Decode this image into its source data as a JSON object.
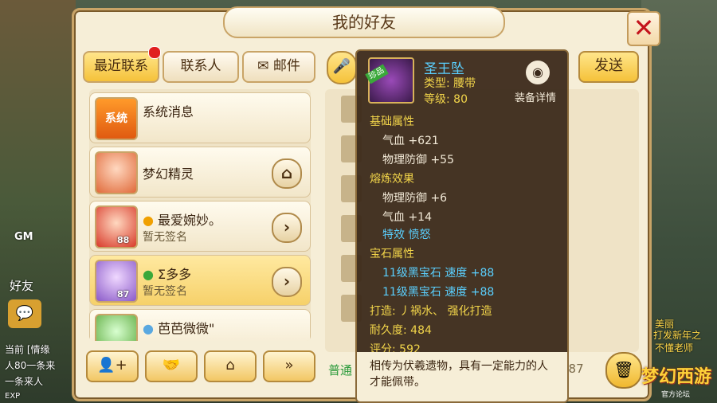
{
  "window": {
    "title": "我的好友",
    "close_label": "✕"
  },
  "tabs": [
    {
      "label": "最近联系",
      "active": true
    },
    {
      "label": "联系人",
      "active": false
    },
    {
      "label": "邮件",
      "active": false
    }
  ],
  "contacts": [
    {
      "name": "系统消息",
      "sub": "",
      "level": "",
      "icon": "系统"
    },
    {
      "name": "梦幻精灵",
      "sub": "",
      "level": ""
    },
    {
      "name": "最爱婉妙。",
      "sub": "暂无签名",
      "level": "88"
    },
    {
      "name": "Σ多多",
      "sub": "暂无签名",
      "level": "87"
    },
    {
      "name": "芭芭微微\"",
      "sub": "",
      "level": ""
    }
  ],
  "chat": {
    "send_label": "发送",
    "mode_label": "普通",
    "tail_text": "787"
  },
  "left_hud": {
    "gm_label": "GM",
    "friend_label": "好友",
    "chat_line1": "当前 [情缘",
    "chat_line2": "人80一条来",
    "chat_line3": "一条来人",
    "exp_label": "EXP"
  },
  "right_hud": {
    "line1": "美丽",
    "line2": "不懂老师",
    "line3": "打发新年之"
  },
  "item_tooltip": {
    "name": "圣王坠",
    "badge": "珍品",
    "type": "类型: 腰带",
    "level": "等级: 80",
    "detail_label": "装备详情",
    "base_header": "基础属性",
    "base_stats": [
      "气血 +621",
      "物理防御 +55"
    ],
    "refine_header": "熔炼效果",
    "refine_stats": [
      "物理防御 +6",
      "气血 +14"
    ],
    "special": "特效 愤怒",
    "gem_header": "宝石属性",
    "gem_stats": [
      "11级黑宝石 速度 +88",
      "11级黑宝石 速度 +88"
    ],
    "forge": "打造: 丿祸水、   强化打造",
    "durability": "耐久度: 484",
    "score": "评分: 592",
    "description": "相传为伏羲遗物，具有一定能力的人才能佩带。"
  },
  "logo": {
    "text": "梦幻西游",
    "sub": "官方论坛"
  },
  "colors": {
    "accent": "#f5c23a",
    "panel": "#f6eed7",
    "tooltip_name": "#5ad0ff"
  }
}
